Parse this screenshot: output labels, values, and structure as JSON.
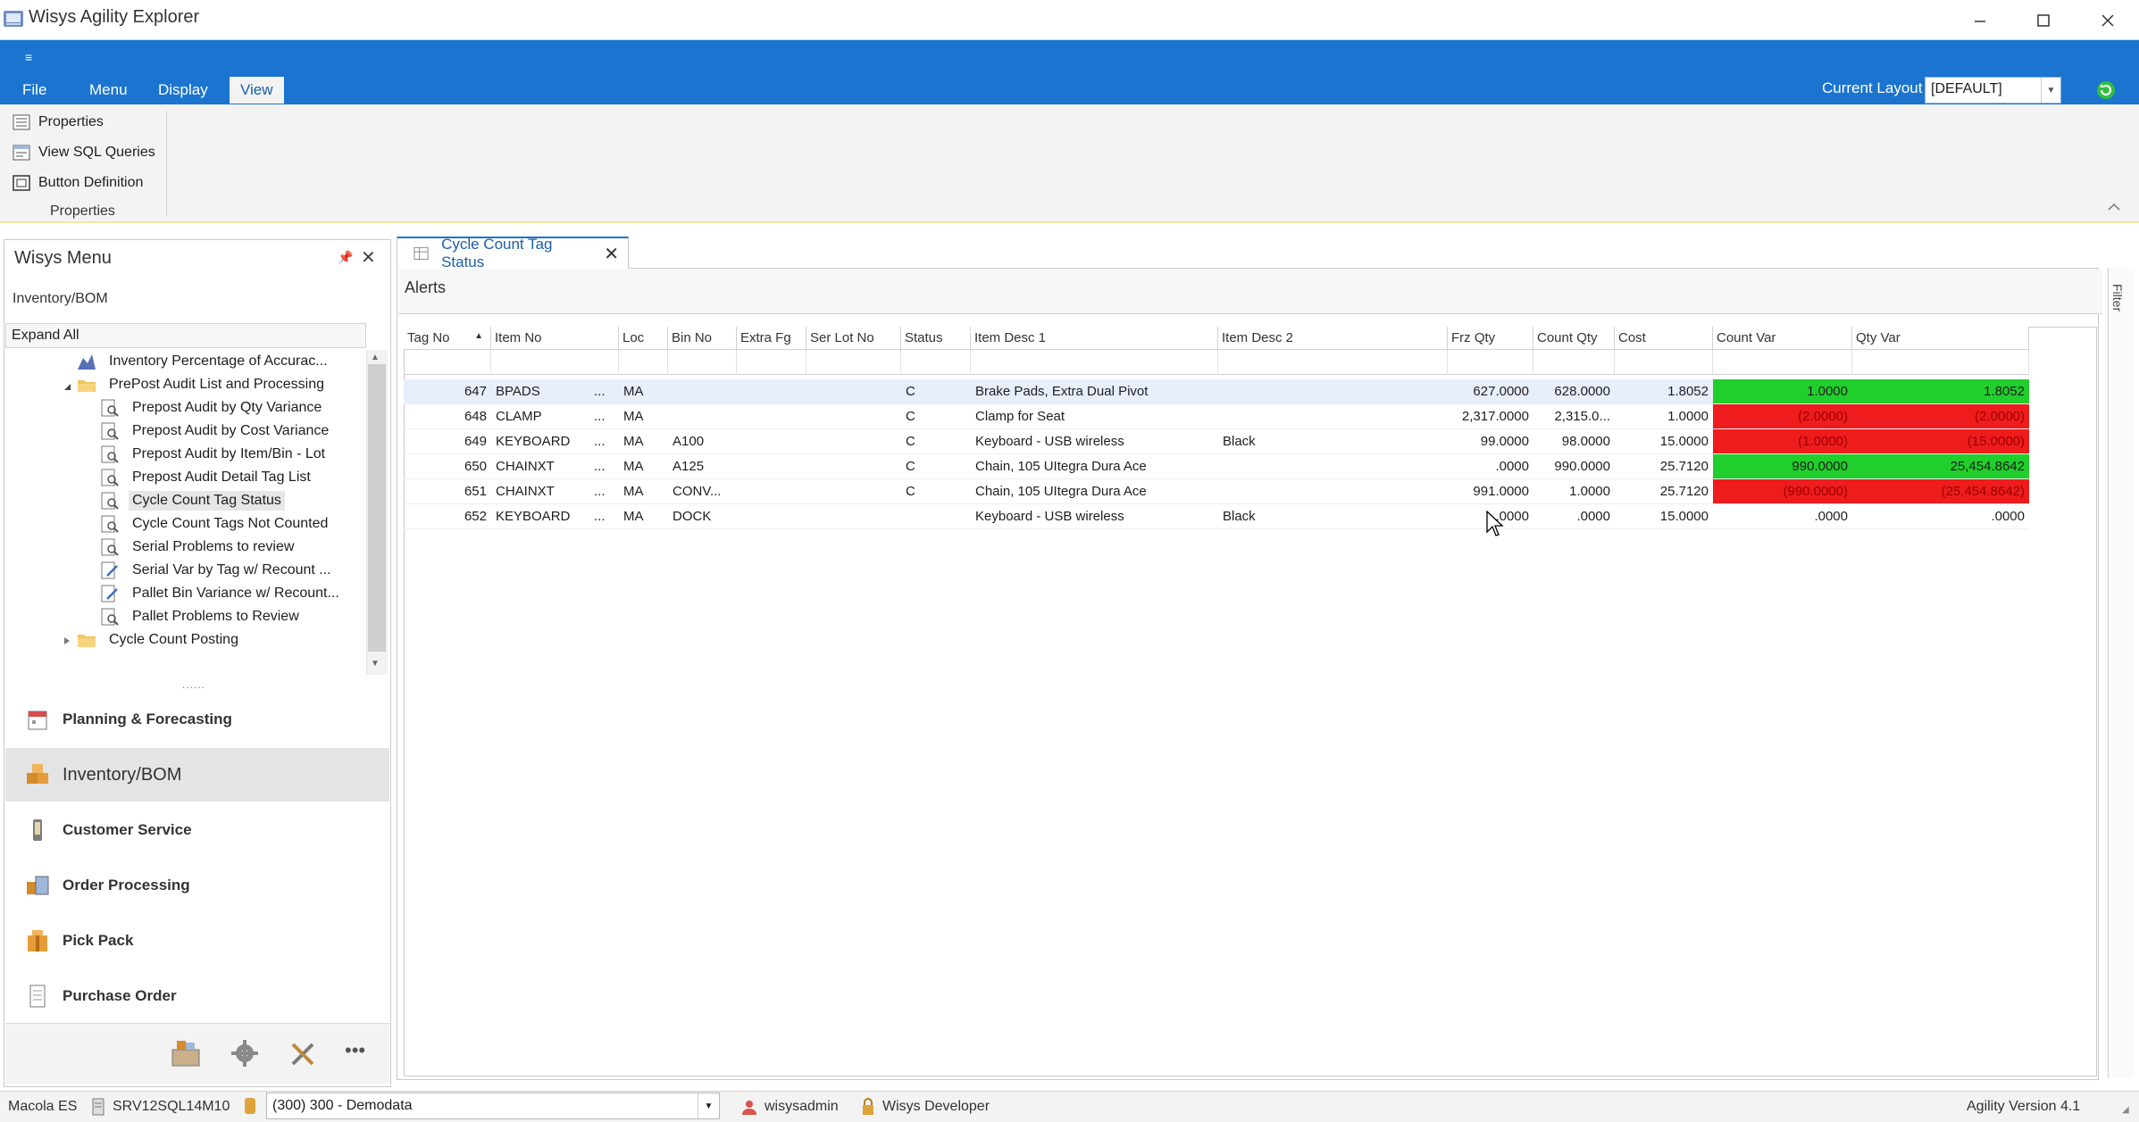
{
  "window": {
    "title": "Wisys Agility Explorer"
  },
  "ribbon": {
    "qat_symbol": "≡",
    "tabs": [
      "File",
      "Menu",
      "Display",
      "View"
    ],
    "active_tab": "View",
    "current_layout_label": "Current Layout",
    "current_layout_value": "[DEFAULT]",
    "buttons": [
      "Properties",
      "View SQL Queries",
      "Button Definition"
    ],
    "group_label": "Properties"
  },
  "menu_panel": {
    "title": "Wisys Menu",
    "breadcrumb": "Inventory/BOM",
    "expand_all": "Expand All",
    "tree": [
      "Inventory Percentage of Accurac...",
      "PrePost Audit List and Processing",
      "Prepost Audit by Qty Variance",
      "Prepost Audit by Cost Variance",
      "Prepost Audit by Item/Bin - Lot",
      "Prepost Audit Detail Tag List",
      "Cycle Count Tag Status",
      "Cycle Count Tags Not Counted",
      "Serial Problems to review",
      "Serial Var by Tag w/ Recount ...",
      "Pallet Bin Variance w/ Recount...",
      "Pallet Problems to Review",
      "Cycle Count Posting"
    ],
    "splitter": "......",
    "groups": [
      "Planning & Forecasting",
      "Inventory/BOM",
      "Customer Service",
      "Order Processing",
      "Pick Pack",
      "Purchase Order"
    ],
    "selected_group": "Inventory/BOM",
    "overflow": "•••"
  },
  "document": {
    "tab_title": "Cycle Count Tag Status",
    "alerts_label": "Alerts",
    "filter_label": "Filter",
    "columns": [
      "Tag No",
      "Item No",
      "Loc",
      "Bin No",
      "Extra Fg",
      "Ser Lot No",
      "Status",
      "Item Desc 1",
      "Item Desc 2",
      "Frz Qty",
      "Count Qty",
      "Cost",
      "Count Var",
      "Qty Var"
    ],
    "rows": [
      {
        "tag": "647",
        "item": "BPADS",
        "more": "...",
        "loc": "MA",
        "bin": "",
        "extra": "",
        "serlot": "",
        "status": "C",
        "desc1": "Brake Pads, Extra Dual Pivot",
        "desc2": "",
        "frz": "627.0000",
        "count": "628.0000",
        "cost": "1.8052",
        "countvar": "1.0000",
        "qtyvar": "1.8052",
        "cv_color": "g",
        "qv_color": "g"
      },
      {
        "tag": "648",
        "item": "CLAMP",
        "more": "...",
        "loc": "MA",
        "bin": "",
        "extra": "",
        "serlot": "",
        "status": "C",
        "desc1": "Clamp for Seat",
        "desc2": "",
        "frz": "2,317.0000",
        "count": "2,315.0...",
        "cost": "1.0000",
        "countvar": "(2.0000)",
        "qtyvar": "(2.0000)",
        "cv_color": "rd",
        "qv_color": "rd"
      },
      {
        "tag": "649",
        "item": "KEYBOARD",
        "more": "...",
        "loc": "MA",
        "bin": "A100",
        "extra": "",
        "serlot": "",
        "status": "C",
        "desc1": "Keyboard - USB wireless",
        "desc2": "Black",
        "frz": "99.0000",
        "count": "98.0000",
        "cost": "15.0000",
        "countvar": "(1.0000)",
        "qtyvar": "(15.0000)",
        "cv_color": "rd",
        "qv_color": "rd"
      },
      {
        "tag": "650",
        "item": "CHAINXT",
        "more": "...",
        "loc": "MA",
        "bin": "A125",
        "extra": "",
        "serlot": "",
        "status": "C",
        "desc1": "Chain, 105 UItegra Dura Ace",
        "desc2": "",
        "frz": ".0000",
        "count": "990.0000",
        "cost": "25.7120",
        "countvar": "990.0000",
        "qtyvar": "25,454.8642",
        "cv_color": "g",
        "qv_color": "g"
      },
      {
        "tag": "651",
        "item": "CHAINXT",
        "more": "...",
        "loc": "MA",
        "bin": "CONV...",
        "extra": "",
        "serlot": "",
        "status": "C",
        "desc1": "Chain, 105 UItegra Dura Ace",
        "desc2": "",
        "frz": "991.0000",
        "count": "1.0000",
        "cost": "25.7120",
        "countvar": "(990.0000)",
        "qtyvar": "(25,454.8642)",
        "cv_color": "rd",
        "qv_color": "rd"
      },
      {
        "tag": "652",
        "item": "KEYBOARD",
        "more": "...",
        "loc": "MA",
        "bin": "DOCK",
        "extra": "",
        "serlot": "",
        "status": "",
        "desc1": "Keyboard - USB wireless",
        "desc2": "Black",
        "frz": ".0000",
        "count": ".0000",
        "cost": "15.0000",
        "countvar": ".0000",
        "qtyvar": ".0000",
        "cv_color": "",
        "qv_color": ""
      }
    ]
  },
  "statusbar": {
    "company": "Macola ES",
    "server": "SRV12SQL14M10",
    "database": "(300) 300 - Demodata",
    "user": "wisysadmin",
    "role": "Wisys Developer",
    "version": "Agility Version 4.1"
  },
  "colors": {
    "ribbon_blue": "#1b74cf",
    "positive_var": "#21cf2c",
    "negative_var": "#ee1c1c"
  }
}
